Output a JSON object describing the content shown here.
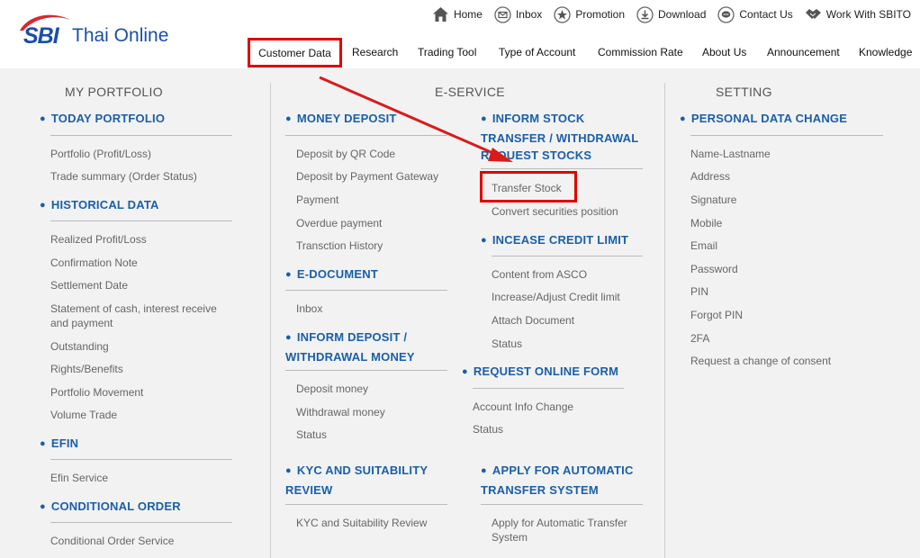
{
  "brand": {
    "logo_sbi": "SBI",
    "logo_text": "Thai Online"
  },
  "top_links": [
    {
      "label": "Home",
      "icon": "home-icon"
    },
    {
      "label": "Inbox",
      "icon": "inbox-icon"
    },
    {
      "label": "Promotion",
      "icon": "star-icon"
    },
    {
      "label": "Download",
      "icon": "download-icon"
    },
    {
      "label": "Contact Us",
      "icon": "chat-icon"
    },
    {
      "label": "Work With SBITO",
      "icon": "handshake-icon"
    }
  ],
  "nav": [
    "Customer Data",
    "Research",
    "Trading Tool",
    "Type of Account",
    "Commission Rate",
    "About Us",
    "Announcement",
    "Knowledge"
  ],
  "columns": {
    "portfolio": "MY PORTFOLIO",
    "eservice": "E-SERVICE",
    "setting": "SETTING"
  },
  "portfolio": {
    "today": {
      "title": "TODAY PORTFOLIO",
      "items": [
        "Portfolio (Profit/Loss)",
        "Trade summary (Order Status)"
      ]
    },
    "historical": {
      "title": "HISTORICAL DATA",
      "items": [
        "Realized Profit/Loss",
        "Confirmation Note",
        "Settlement Date",
        "Statement of cash, interest receive and payment",
        "Outstanding",
        "Rights/Benefits",
        "Portfolio Movement",
        "Volume Trade"
      ]
    },
    "efin": {
      "title": "EFIN",
      "items": [
        "Efin Service"
      ]
    },
    "conditional": {
      "title": "CONDITIONAL ORDER",
      "items": [
        "Conditional Order Service"
      ]
    }
  },
  "eservice": {
    "money_deposit": {
      "title": "MONEY DEPOSIT",
      "items": [
        "Deposit by QR Code",
        "Deposit by Payment Gateway",
        "Payment",
        "Overdue payment",
        "Transction History"
      ]
    },
    "edocument": {
      "title": "E-DOCUMENT",
      "items": [
        "Inbox"
      ]
    },
    "inform_deposit": {
      "title": "INFORM DEPOSIT / WITHDRAWAL MONEY",
      "items": [
        "Deposit money",
        "Withdrawal money",
        "Status"
      ]
    },
    "kyc": {
      "title": "KYC AND SUITABILITY REVIEW",
      "items": [
        "KYC and Suitability Review"
      ]
    },
    "inform_stock": {
      "title": "INFORM STOCK TRANSFER / WITHDRAWAL REQUEST STOCKS",
      "items": [
        "Transfer Stock",
        "Convert securities position"
      ]
    },
    "credit": {
      "title": "INCEASE CREDIT LIMIT",
      "items": [
        "Content from ASCO",
        "Increase/Adjust Credit limit",
        "Attach Document",
        "Status"
      ]
    },
    "online_form": {
      "title": "REQUEST ONLINE FORM",
      "items": [
        "Account Info Change",
        "Status"
      ]
    },
    "auto_transfer": {
      "title": "APPLY FOR AUTOMATIC TRANSFER SYSTEM",
      "items": [
        "Apply for Automatic Transfer System"
      ]
    }
  },
  "setting": {
    "personal": {
      "title": "PERSONAL DATA CHANGE",
      "items": [
        "Name-Lastname",
        "Address",
        "Signature",
        "Mobile",
        "Email",
        "Password",
        "PIN",
        "Forgot PIN",
        "2FA",
        "Request a change of consent"
      ]
    }
  },
  "colors": {
    "accent": "#1a5fa8",
    "highlight": "#e00000"
  }
}
